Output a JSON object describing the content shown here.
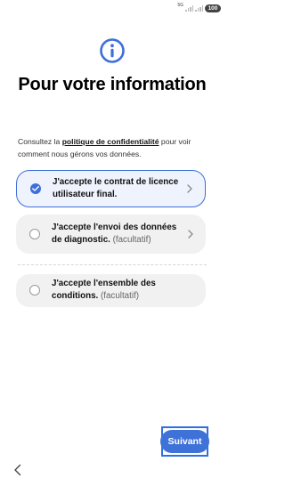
{
  "status_bar": {
    "network": "5G",
    "battery": "100"
  },
  "title": "Pour votre information",
  "consult": {
    "prefix": "Consultez la ",
    "link": "politique de confidentialité",
    "suffix": " pour voir comment nous gérons vos données."
  },
  "options": [
    {
      "label": "J'accepte le contrat de licence utilisateur final.",
      "optional": "",
      "checked": true
    },
    {
      "label": "J'accepte l'envoi des données de diagnostic.",
      "optional": "(facultatif)",
      "checked": false
    },
    {
      "label": "J'accepte l'ensemble des conditions.",
      "optional": "(facultatif)",
      "checked": false
    }
  ],
  "next_button": "Suivant",
  "colors": {
    "accent": "#3e6fd9",
    "selected_bg": "#eef3fd",
    "option_bg": "#f1f1f1",
    "highlight_border": "#2f6fe0"
  },
  "icons": {
    "header": "info-icon",
    "option_arrow": "chevron-right-icon",
    "back": "chevron-left-icon"
  }
}
